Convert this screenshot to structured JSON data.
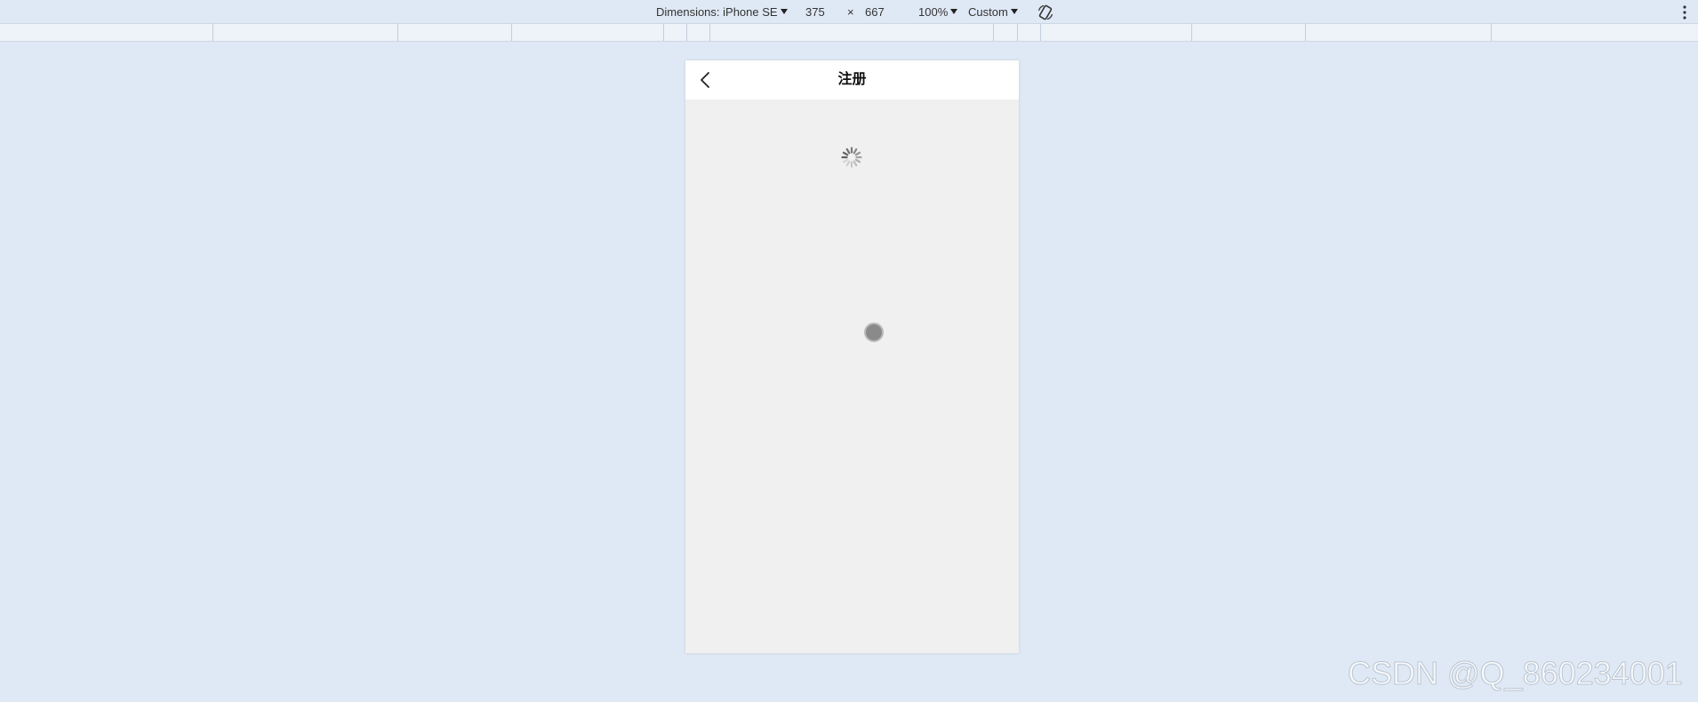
{
  "toolbar": {
    "dimensions_label": "Dimensions: iPhone SE",
    "width": "375",
    "times": "×",
    "height": "667",
    "zoom": "100%",
    "throttle": "Custom"
  },
  "phone": {
    "nav_title": "注册"
  },
  "watermark": "CSDN @Q_860234001"
}
